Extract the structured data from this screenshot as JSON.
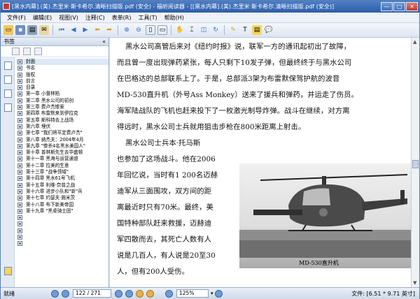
{
  "window": {
    "title": "[黑水内幕].(美).杰里米·斯卡希尔.清晰扫描版.pdf (安全) - 福昕阅读器 - [[黑水内幕].(美).杰里米·斯卡希尔.清晰扫描版.pdf (安全)]",
    "min": "—",
    "max": "□",
    "close": "✕"
  },
  "menu": [
    "文件(F)",
    "编辑(E)",
    "视图(V)",
    "注释(C)",
    "表单(R)",
    "工具(T)",
    "帮助(H)"
  ],
  "sidebar": {
    "header": "书签",
    "close": "«",
    "items": [
      "封面",
      "书名",
      "版权",
      "前言",
      "目录",
      "第一章 小督林陷",
      "第二章 黑水公司的初创",
      "第三章 费卢杰惨案",
      "第四章 布雷默来到伊拉克",
      "第五章 斯科特去上战场",
      "第六章 埋伏",
      "第七章 \"我们将平定费卢杰\"",
      "第八章 纳杰夫：2004年4月",
      "第九章 \"惨杀4名黑水美国人\"",
      "第十章 普林斯先生去华盛顿",
      "第十一章 黑海与运营通道",
      "第十二章 拉美的生意",
      "第十三章 \"战争领域\"",
      "第十四章 黑水61号飞机",
      "第十五章 利维·奈普之战",
      "第十六章 进步小队和\"新\"兵",
      "第十七章 约瑟夫·施米茨",
      "第十八章 布下新美帝国",
      "第十九章 \"黑桌骑士团\""
    ]
  },
  "page_text": [
    "黑水公司高管后来对《纽约时报》说，联军一方的通讯起初出了故障，",
    "而且曾一度出现弹药紧张，每人只剩下10发子弹，但最终终于与黑水公司",
    "在巴格达的总部联系上了。于是，总部派3架为布雷默保驾护航的波音",
    "MD-530直升机（外号Ass Monkey）送来了援兵和弹药，并运走了伤员。",
    "海军陆战队的飞机也赶来投下了一枚激光制导炸弹。战斗在继续，对方离",
    "得远时，黑水公司士兵就用狙击步枪在800米距离上射击。",
    "黑水公司士兵本·托马斯",
    "也参加了这场战斗。他在2006",
    "年回忆说，当时有1 200名迈赫",
    "迪军从三面围攻，双方间的距",
    "离最近时只有70米。最终，美",
    "国特种部队赶来救援，迈赫迪",
    "军四散而去，其死亡人数有人",
    "说是几百人，有人说是20至30",
    "人，但有200人受伤。"
  ],
  "caption": "MD-530直升机",
  "status": {
    "left": "就绪",
    "page": "122 / 271",
    "zoom": "125%",
    "docinfo": "文件: [6.51 * 9.71 英寸]"
  }
}
